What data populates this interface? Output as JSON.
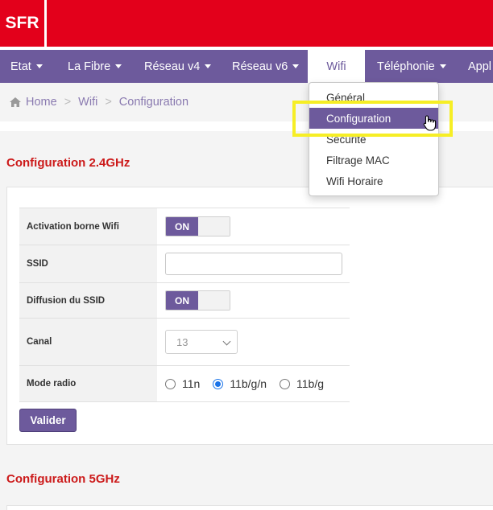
{
  "brand": {
    "logo_text": "SFR",
    "color": "#e3001b"
  },
  "nav": {
    "accent": "#6d5a9c",
    "items": [
      {
        "label": "Etat",
        "has_caret": true
      },
      {
        "label": "La Fibre",
        "has_caret": true
      },
      {
        "label": "Réseau v4",
        "has_caret": true
      },
      {
        "label": "Réseau v6",
        "has_caret": true
      },
      {
        "label": "Wifi",
        "has_caret": false,
        "active": true
      },
      {
        "label": "Téléphonie",
        "has_caret": true
      },
      {
        "label": "Appl",
        "has_caret": false
      }
    ]
  },
  "wifi_menu": {
    "items": [
      "Général",
      "Configuration",
      "Sécurité",
      "Filtrage MAC",
      "Wifi Horaire"
    ],
    "active_index": 1
  },
  "breadcrumb": {
    "items": [
      "Home",
      "Wifi",
      "Configuration"
    ],
    "separator": ">"
  },
  "section_24": {
    "title": "Configuration 2.4GHz",
    "rows": {
      "activation": {
        "label": "Activation borne Wifi",
        "toggle": "ON"
      },
      "ssid": {
        "label": "SSID",
        "value": ""
      },
      "diffusion": {
        "label": "Diffusion du SSID",
        "toggle": "ON"
      },
      "canal": {
        "label": "Canal",
        "value": "13"
      },
      "mode_radio": {
        "label": "Mode radio",
        "options": [
          "11n",
          "11b/g/n",
          "11b/g"
        ],
        "selected": "11b/g/n"
      }
    },
    "submit_label": "Valider"
  },
  "section_5": {
    "title": "Configuration 5GHz"
  },
  "icons": {
    "home": "home-icon",
    "caret": "caret-down-icon",
    "select_chevron": "chevron-down-icon",
    "cursor": "hand-pointer-icon"
  },
  "highlight_color": "#f6ee25"
}
